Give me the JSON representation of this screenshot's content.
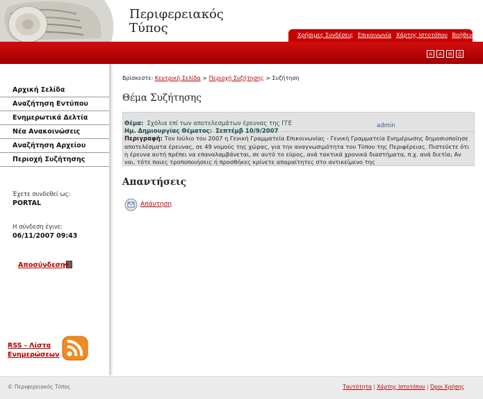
{
  "site": {
    "title_line1": "Περιφερειακός",
    "title_line2": "Τύπος"
  },
  "toplinks": [
    "Χρήσιμες Συνδέσεις",
    "Επικοινωνία",
    "Χάρτης Ιστοτόπου",
    "Βοήθεια"
  ],
  "tools": [
    "A",
    "A",
    "✉",
    "⎙"
  ],
  "nav": {
    "items": [
      "Αρχική Σελίδα",
      "Αναζήτηση Εντύπου",
      "Ενημερωτικά Δελτία",
      "Νέα Ανακοινώσεις",
      "Αναζήτηση Αρχείου",
      "Περιοχή Συζήτησης"
    ]
  },
  "login": {
    "connected_label": "Έχετε συνδεθεί ως:",
    "user": "PORTAL",
    "time_label": "Η σύνδεση έγινε:",
    "time": "06/11/2007 09:43",
    "logout": "Αποσύνδεση"
  },
  "rss": {
    "line1": "RSS - Λίστα",
    "line2": "Ενημερώσεων"
  },
  "breadcrumb": {
    "prefix": "Βρίσκεστε:",
    "home": "Κεντρική Σελίδα",
    "sep": ">",
    "area": "Περιοχή Συζήτησης",
    "current": "Συζήτηση"
  },
  "topic": {
    "heading": "Θέμα Συζήτησης",
    "subject_label": "Θέμα:",
    "subject": "Σχόλια επί των αποτελεσμάτων έρευνας της ΓΓΕ",
    "date_label": "Ημ. Δημιουργίας Θέματος:",
    "date": "Σεπτέμβ 10/9/2007",
    "author": "admin",
    "desc_label": "Περιγραφή:",
    "description": "Τον Ιούλιο του 2007 η Γενική Γραμματεία Επικοινωνίας - Γενική Γραμματεία Ενημέρωσης δημοσιοποίησε αποτελέσματα έρευνας, σε 49 νομούς της χώρας, για την αναγνωσιμότητα του Τύπου της Περιφέρειας. Πιστεύετε ότι η έρευνα αυτή πρέπει να επαναλαμβάνεται, σε αυτό το εύρος, ανά τακτικά χρονικά διαστήματα, π.χ. ανά διετία; Αν ναι, τότε ποιες τροποποιήσεις ή προσθήκες κρίνετε απαραίτητες στο αντικείμενο της"
  },
  "replies": {
    "heading": "Απαντήσεις",
    "reply_link": "Απάντηση"
  },
  "footer": {
    "copyright": "© Περιφερειακός Τύπος",
    "links": [
      "Ταυτότητα",
      "Χάρτης Ιστοτόπου",
      "Όροι Χρήσης"
    ],
    "sep": "|"
  },
  "colors": {
    "brand_red": "#c70000",
    "link_red": "#b00000",
    "topic_box": "#e2e2e2"
  }
}
